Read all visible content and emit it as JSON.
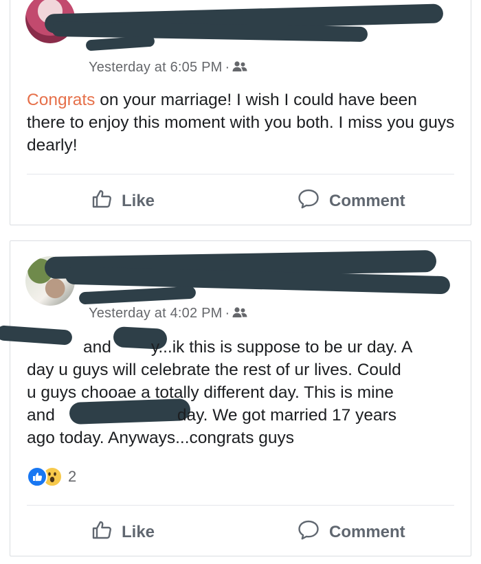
{
  "posts": [
    {
      "timestamp": "Yesterday at 6:05 PM",
      "separator": "·",
      "audience_icon": "friends-icon",
      "text_link": "Congrats",
      "text_rest": " on your marriage! I wish I could have been there to enjoy this moment with you both. I miss you guys dearly!",
      "like_label": "Like",
      "comment_label": "Comment"
    },
    {
      "timestamp": "Yesterday at 4:02 PM",
      "separator": "·",
      "audience_icon": "friends-icon",
      "text_line1_a": "and",
      "text_line1_b": "y...ik this is suppose to be ur day. A",
      "text_line2": "day u guys will celebrate the rest of ur lives. Could",
      "text_line3": "u guys chooae a totally different day. This is mine",
      "text_line4_a": "and",
      "text_line4_b": "day. We got married 17 years",
      "text_line5": "ago today. Anyways...congrats guys",
      "reactions": [
        "like-icon",
        "wow-icon"
      ],
      "reaction_count": "2",
      "like_label": "Like",
      "comment_label": "Comment"
    }
  ],
  "colors": {
    "link": "#e6704a",
    "redaction": "#2e3f48",
    "meta": "#65676b",
    "action": "#606770"
  }
}
